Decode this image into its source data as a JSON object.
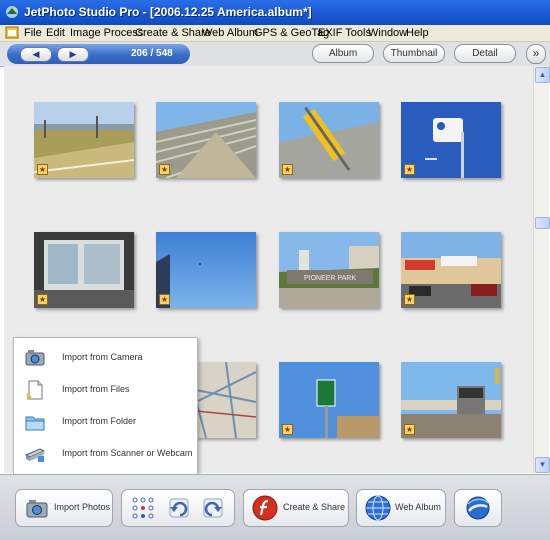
{
  "window": {
    "title": "JetPhoto Studio Pro - [2006.12.25 America.album*]"
  },
  "menu": [
    "File",
    "Edit",
    "Image Process",
    "Create & Share",
    "Web Album",
    "GPS & GeoTag",
    "EXIF Tools",
    "Window",
    "Help"
  ],
  "toolbar": {
    "page_counter": "206 / 548",
    "view_buttons": [
      "Album",
      "Thumbnail",
      "Detail"
    ]
  },
  "import_menu": {
    "items": [
      {
        "label": "Import from Camera",
        "icon": "camera-icon"
      },
      {
        "label": "Import from Files",
        "icon": "file-icon"
      },
      {
        "label": "Import from Folder",
        "icon": "folder-icon"
      },
      {
        "label": "Import from Scanner or Webcam",
        "icon": "scanner-icon"
      }
    ]
  },
  "bottom_bar": {
    "import_photos": "Import Photos",
    "create_share": "Create & Share",
    "web_album": "Web Album"
  },
  "thumbnails": [
    {
      "scene": "sports-field"
    },
    {
      "scene": "stadium-bleachers"
    },
    {
      "scene": "yellow-sign"
    },
    {
      "scene": "transit-sign"
    },
    {
      "scene": "train-interior"
    },
    {
      "scene": "blue-sky"
    },
    {
      "scene": "pioneer-park",
      "sign_text": "PIONEER PARK"
    },
    {
      "scene": "gas-station"
    },
    {
      "scene": "map"
    },
    {
      "scene": "highway-sign"
    },
    {
      "scene": "train-station"
    }
  ]
}
